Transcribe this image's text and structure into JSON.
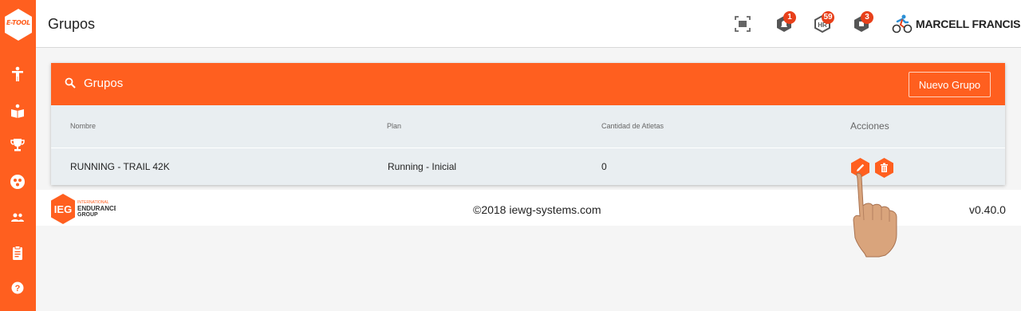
{
  "app": {
    "logo_text": "E-TOOL",
    "brand_color": "#ff5f1f"
  },
  "sidebar": {
    "items": [
      {
        "icon": "person-icon"
      },
      {
        "icon": "open-book-icon"
      },
      {
        "icon": "trophy-icon"
      },
      {
        "icon": "group-circle-icon"
      },
      {
        "icon": "users-icon"
      },
      {
        "icon": "clipboard-icon"
      },
      {
        "icon": "help-icon"
      }
    ]
  },
  "header": {
    "title": "Grupos",
    "icons": [
      {
        "icon": "fullscreen-icon",
        "badge": ""
      },
      {
        "icon": "notification-shield-icon",
        "badge": "1"
      },
      {
        "icon": "hr-shield-icon",
        "badge": "59"
      },
      {
        "icon": "alert-shield-icon",
        "badge": "3"
      }
    ],
    "user": {
      "avatar_icon": "cyclist-icon",
      "name": "MARCELL FRANCIS"
    }
  },
  "groups": {
    "title": "Grupos",
    "search_icon": "search-icon",
    "new_button": "Nuevo Grupo",
    "columns": [
      "Nombre",
      "Plan",
      "Cantidad de Atletas",
      "Acciones"
    ],
    "rows": [
      {
        "name": "RUNNING - TRAIL 42K",
        "plan": "Running - Inicial",
        "athletes": "0"
      }
    ],
    "actions": [
      {
        "icon": "edit-icon"
      },
      {
        "icon": "delete-icon"
      }
    ]
  },
  "footer": {
    "logo_mark": "IEG",
    "logo_lines": [
      "INTERNATIONAL",
      "ENDURANCE",
      "GROUP"
    ],
    "copyright": "©2018 iewg-systems.com",
    "version": "v0.40.0"
  }
}
